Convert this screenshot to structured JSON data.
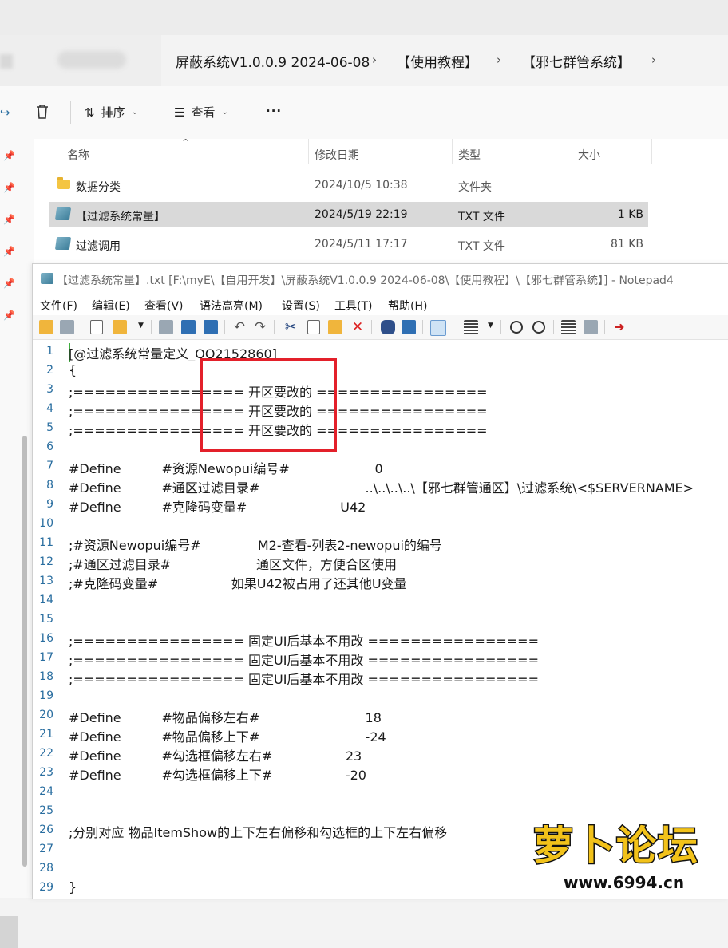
{
  "explorer": {
    "breadcrumbs": [
      "屏蔽系统V1.0.0.9 2024-06-08",
      "【使用教程】",
      "【邪七群管系统】"
    ],
    "toolbar": {
      "sort_label": "排序",
      "view_label": "查看",
      "more_label": "···"
    },
    "columns": [
      "名称",
      "修改日期",
      "类型",
      "大小"
    ],
    "files": [
      {
        "name": "数据分类",
        "date": "2024/10/5 10:38",
        "type": "文件夹",
        "size": "",
        "icon": "folder-icon"
      },
      {
        "name": "【过滤系统常量】",
        "date": "2024/5/19 22:19",
        "type": "TXT 文件",
        "size": "1 KB",
        "icon": "txt-file-icon",
        "selected": true
      },
      {
        "name": "过滤调用",
        "date": "2024/5/11 17:17",
        "type": "TXT 文件",
        "size": "81 KB",
        "icon": "txt-file-icon"
      }
    ]
  },
  "notepad": {
    "title": "【过滤系统常量】.txt [F:\\myE\\【自用开发】\\屏蔽系统V1.0.0.9 2024-06-08\\【使用教程】\\【邪七群管系统】] - Notepad4",
    "menu": [
      "文件(F)",
      "编辑(E)",
      "查看(V)",
      "语法高亮(M)",
      "设置(S)",
      "工具(T)",
      "帮助(H)"
    ],
    "lines": [
      {
        "n": "1",
        "text": "[@过滤系统常量定义_QQ2152860]"
      },
      {
        "n": "2",
        "text": "{"
      },
      {
        "n": "3",
        "text": ";================ 开区要改的 ================"
      },
      {
        "n": "4",
        "text": ";================ 开区要改的 ================"
      },
      {
        "n": "5",
        "text": ";================ 开区要改的 ================"
      },
      {
        "n": "6",
        "text": ""
      },
      {
        "n": "7",
        "text": "#Define          #资源Newopui编号#                     0"
      },
      {
        "n": "8",
        "text": "#Define          #通区过滤目录#                          ..\\..\\..\\..\\【邪七群管通区】\\过滤系统\\<$SERVERNAME>"
      },
      {
        "n": "9",
        "text": "#Define          #克隆码变量#                       U42"
      },
      {
        "n": "10",
        "text": ""
      },
      {
        "n": "11",
        "text": ";#资源Newopui编号#              M2-查看-列表2-newopui的编号"
      },
      {
        "n": "12",
        "text": ";#通区过滤目录#                     通区文件，方便合区使用"
      },
      {
        "n": "13",
        "text": ";#克隆码变量#                  如果U42被占用了还其他U变量"
      },
      {
        "n": "14",
        "text": ""
      },
      {
        "n": "15",
        "text": ""
      },
      {
        "n": "16",
        "text": ";================ 固定UI后基本不用改 ================"
      },
      {
        "n": "17",
        "text": ";================ 固定UI后基本不用改 ================"
      },
      {
        "n": "18",
        "text": ";================ 固定UI后基本不用改 ================"
      },
      {
        "n": "19",
        "text": ""
      },
      {
        "n": "20",
        "text": "#Define          #物品偏移左右#                          18"
      },
      {
        "n": "21",
        "text": "#Define          #物品偏移上下#                          -24"
      },
      {
        "n": "22",
        "text": "#Define          #勾选框偏移左右#                  23"
      },
      {
        "n": "23",
        "text": "#Define          #勾选框偏移上下#                  -20"
      },
      {
        "n": "24",
        "text": ""
      },
      {
        "n": "25",
        "text": ""
      },
      {
        "n": "26",
        "text": ";分别对应 物品ItemShow的上下左右偏移和勾选框的上下左右偏移"
      },
      {
        "n": "27",
        "text": ""
      },
      {
        "n": "28",
        "text": ""
      },
      {
        "n": "29",
        "text": "}"
      }
    ]
  },
  "watermark": {
    "brand": "萝卜论坛",
    "url": "www.6994.cn"
  },
  "colors": {
    "highlight_box": "#e3202a",
    "line_numbers": "#2a6ea0",
    "selected_row": "#d9d9d9"
  }
}
